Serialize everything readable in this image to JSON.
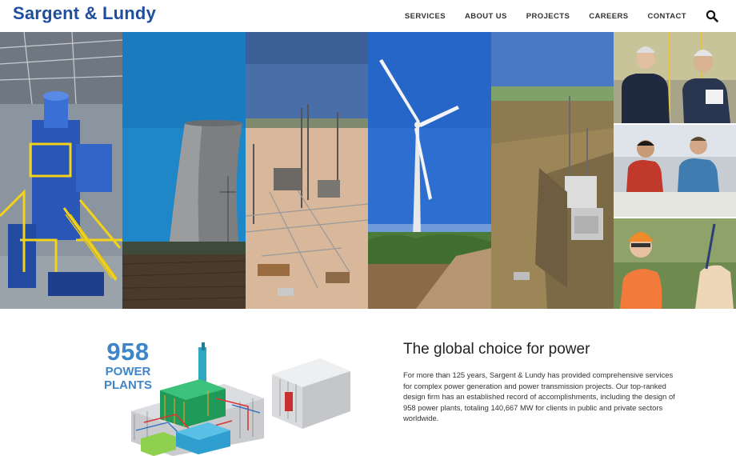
{
  "header": {
    "logo_text": "Sargent & Lundy",
    "nav": [
      "SERVICES",
      "ABOUT US",
      "PROJECTS",
      "CAREERS",
      "CONTACT"
    ],
    "search_icon": "search-icon"
  },
  "hero": {
    "panels": [
      "industrial-plant-photo",
      "cooling-tower-photo",
      "substation-photo",
      "wind-turbine-photo",
      "transmission-site-photo",
      "engineers-collage-photo"
    ]
  },
  "stats": {
    "number": "958",
    "label_line1": "POWER",
    "label_line2": "PLANTS"
  },
  "intro": {
    "headline": "The global choice for power",
    "body": "For more than 125 years, Sargent & Lundy has provided comprehensive services for complex power generation and power transmission projects. Our top-ranked design firm has an established record of accomplishments, including the design of 958 power plants, totaling 140,667 MW for clients in public and private sectors worldwide."
  },
  "colors": {
    "brand_blue": "#1f4e9f",
    "stat_blue": "#3f86c8"
  }
}
